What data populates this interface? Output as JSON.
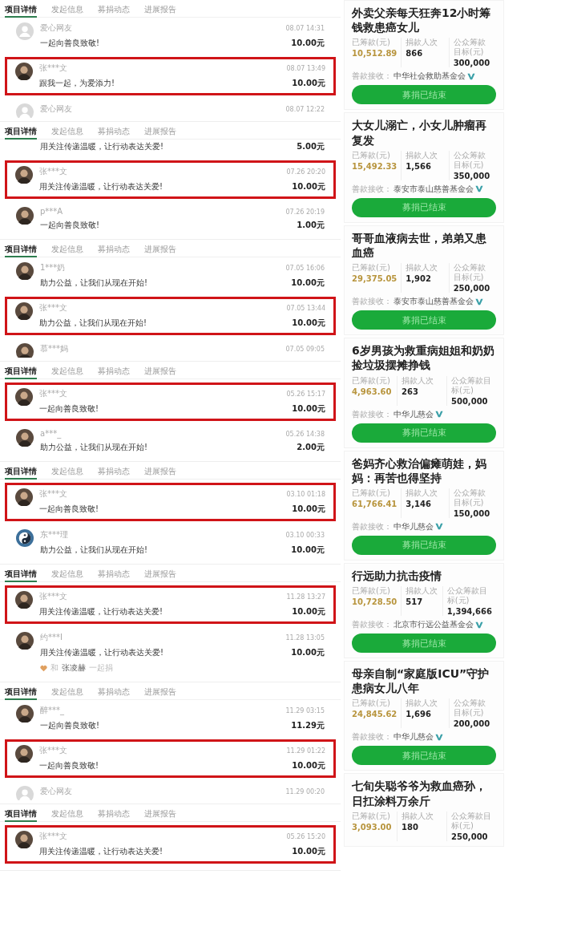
{
  "donation_panels": [
    {
      "tabs": [
        {
          "label": "项目详情",
          "selected": true
        },
        {
          "label": "发起信息",
          "selected": false
        },
        {
          "label": "募捐动态",
          "selected": false
        },
        {
          "label": "进展报告",
          "selected": false
        }
      ],
      "rows": [
        {
          "kind": "full",
          "avatar": {
            "kind": "default"
          },
          "name": "爱心网友",
          "time": "08.07 14:31",
          "message": "一起向善良致敬!",
          "amount": "10.00元",
          "highlighted": false
        },
        {
          "kind": "full",
          "avatar": {
            "kind": "photo"
          },
          "name": "张***文",
          "time": "08.07 13:49",
          "message": "跟我一起，为爱添力!",
          "amount": "10.00元",
          "highlighted": true
        },
        {
          "kind": "name_only",
          "avatar": {
            "kind": "default"
          },
          "name": "爱心网友",
          "time": "08.07 12:22",
          "highlighted": false
        }
      ]
    },
    {
      "tabs": [
        {
          "label": "项目详情",
          "selected": true
        },
        {
          "label": "发起信息",
          "selected": false
        },
        {
          "label": "募捐动态",
          "selected": false
        },
        {
          "label": "进展报告",
          "selected": false
        }
      ],
      "rows": [
        {
          "kind": "message_only",
          "message": "用关注传递温暖，让行动表达关爱!",
          "amount": "5.00元",
          "highlighted": false
        },
        {
          "kind": "full",
          "avatar": {
            "kind": "photo"
          },
          "name": "张***文",
          "time": "07.26 20:20",
          "message": "用关注传递温暖，让行动表达关爱!",
          "amount": "10.00元",
          "highlighted": true
        },
        {
          "kind": "full",
          "avatar": {
            "kind": "photo"
          },
          "name": "p***A",
          "time": "07.26 20:19",
          "message": "一起向善良致敬!",
          "amount": "1.00元",
          "highlighted": false
        }
      ]
    },
    {
      "tabs": [
        {
          "label": "项目详情",
          "selected": true
        },
        {
          "label": "发起信息",
          "selected": false
        },
        {
          "label": "募捐动态",
          "selected": false
        },
        {
          "label": "进展报告",
          "selected": false
        }
      ],
      "rows": [
        {
          "kind": "full",
          "avatar": {
            "kind": "photo"
          },
          "name": "1***奶",
          "time": "07.05 16:06",
          "message": "助力公益，让我们从现在开始!",
          "amount": "10.00元",
          "highlighted": false
        },
        {
          "kind": "full",
          "avatar": {
            "kind": "photo"
          },
          "name": "张***文",
          "time": "07.05 13:44",
          "message": "助力公益，让我们从现在开始!",
          "amount": "10.00元",
          "highlighted": true
        },
        {
          "kind": "name_only",
          "avatar": {
            "kind": "photo"
          },
          "name": "慕***妈",
          "time": "07.05 09:05",
          "highlighted": false
        }
      ]
    },
    {
      "tabs": [
        {
          "label": "项目详情",
          "selected": true
        },
        {
          "label": "发起信息",
          "selected": false
        },
        {
          "label": "募捐动态",
          "selected": false
        },
        {
          "label": "进展报告",
          "selected": false
        }
      ],
      "rows": [
        {
          "kind": "full",
          "avatar": {
            "kind": "photo"
          },
          "name": "张***文",
          "time": "05.26 15:17",
          "message": "一起向善良致敬!",
          "amount": "10.00元",
          "highlighted": true
        },
        {
          "kind": "full",
          "avatar": {
            "kind": "photo"
          },
          "name": "a***_",
          "time": "05.26 14:38",
          "message": "助力公益，让我们从现在开始!",
          "amount": "2.00元",
          "highlighted": false
        }
      ]
    },
    {
      "tabs": [
        {
          "label": "项目详情",
          "selected": true
        },
        {
          "label": "发起信息",
          "selected": false
        },
        {
          "label": "募捐动态",
          "selected": false
        },
        {
          "label": "进展报告",
          "selected": false
        }
      ],
      "rows": [
        {
          "kind": "full",
          "avatar": {
            "kind": "photo"
          },
          "name": "张***文",
          "time": "03.10 01:18",
          "message": "一起向善良致敬!",
          "amount": "10.00元",
          "highlighted": true
        },
        {
          "kind": "full",
          "avatar": {
            "kind": "yinyang"
          },
          "name": "东***理",
          "time": "03.10 00:33",
          "message": "助力公益，让我们从现在开始!",
          "amount": "10.00元",
          "highlighted": false
        }
      ]
    },
    {
      "tabs": [
        {
          "label": "项目详情",
          "selected": true
        },
        {
          "label": "发起信息",
          "selected": false
        },
        {
          "label": "募捐动态",
          "selected": false
        },
        {
          "label": "进展报告",
          "selected": false
        }
      ],
      "rows": [
        {
          "kind": "full",
          "avatar": {
            "kind": "photo"
          },
          "name": "张***文",
          "time": "11.28 13:27",
          "message": "用关注传递温暖，让行动表达关爱!",
          "amount": "10.00元",
          "highlighted": true
        },
        {
          "kind": "full",
          "avatar": {
            "kind": "photo"
          },
          "name": "约***I",
          "time": "11.28 13:05",
          "message": "用关注传递温暖，让行动表达关爱!",
          "amount": "10.00元",
          "highlighted": false,
          "together": {
            "prefix": "和",
            "name": "张凌赫",
            "suffix": "一起捐"
          }
        }
      ]
    },
    {
      "tabs": [
        {
          "label": "项目详情",
          "selected": true
        },
        {
          "label": "发起信息",
          "selected": false
        },
        {
          "label": "募捐动态",
          "selected": false
        },
        {
          "label": "进展报告",
          "selected": false
        }
      ],
      "rows": [
        {
          "kind": "full",
          "avatar": {
            "kind": "photo"
          },
          "name": "醉***_",
          "time": "11.29 03:15",
          "message": "一起向善良致敬!",
          "amount": "11.29元",
          "highlighted": false
        },
        {
          "kind": "full",
          "avatar": {
            "kind": "photo"
          },
          "name": "张***文",
          "time": "11.29 01:22",
          "message": "一起向善良致敬!",
          "amount": "10.00元",
          "highlighted": true
        },
        {
          "kind": "name_only",
          "avatar": {
            "kind": "default"
          },
          "name": "爱心网友",
          "time": "11.29 00:20",
          "highlighted": false
        }
      ]
    },
    {
      "tabs": [
        {
          "label": "项目详情",
          "selected": true
        },
        {
          "label": "发起信息",
          "selected": false
        },
        {
          "label": "募捐动态",
          "selected": false
        },
        {
          "label": "进展报告",
          "selected": false
        }
      ],
      "rows": [
        {
          "kind": "full",
          "avatar": {
            "kind": "photo"
          },
          "name": "张***文",
          "time": "05.26 15:20",
          "message": "用关注传递温暖，让行动表达关爱!",
          "amount": "10.00元",
          "highlighted": true
        }
      ]
    }
  ],
  "project_cards": [
    {
      "title": "外卖父亲每天狂奔12小时筹钱救患癌女儿",
      "stats": [
        {
          "label": "已筹款(元)",
          "value": "10,512.89"
        },
        {
          "label": "捐款人次",
          "value": "866"
        },
        {
          "label": "公众筹款目标(元)",
          "value": "300,000"
        }
      ],
      "recipient_label": "善款接收：",
      "recipient": "中华社会救助基金会",
      "button": "募捐已结束"
    },
    {
      "title": "大女儿溺亡，小女儿肿瘤再复发",
      "stats": [
        {
          "label": "已筹款(元)",
          "value": "15,492.33"
        },
        {
          "label": "捐款人次",
          "value": "1,566"
        },
        {
          "label": "公众筹款目标(元)",
          "value": "350,000"
        }
      ],
      "recipient_label": "善款接收：",
      "recipient": "泰安市泰山慈善基金会",
      "button": "募捐已结束"
    },
    {
      "title": "哥哥血液病去世，弟弟又患血癌",
      "stats": [
        {
          "label": "已筹款(元)",
          "value": "29,375.05"
        },
        {
          "label": "捐款人次",
          "value": "1,902"
        },
        {
          "label": "公众筹款目标(元)",
          "value": "250,000"
        }
      ],
      "recipient_label": "善款接收：",
      "recipient": "泰安市泰山慈善基金会",
      "button": "募捐已结束"
    },
    {
      "title": "6岁男孩为救重病姐姐和奶奶捡垃圾摆摊挣钱",
      "stats": [
        {
          "label": "已筹款(元)",
          "value": "4,963.60"
        },
        {
          "label": "捐款人次",
          "value": "263"
        },
        {
          "label": "公众筹款目标(元)",
          "value": "500,000"
        }
      ],
      "recipient_label": "善款接收：",
      "recipient": "中华儿慈会",
      "button": "募捐已结束"
    },
    {
      "title": "爸妈齐心救治偏瘫萌娃，妈妈：再苦也得坚持",
      "stats": [
        {
          "label": "已筹款(元)",
          "value": "61,766.41"
        },
        {
          "label": "捐款人次",
          "value": "3,146"
        },
        {
          "label": "公众筹款目标(元)",
          "value": "150,000"
        }
      ],
      "recipient_label": "善款接收：",
      "recipient": "中华儿慈会",
      "button": "募捐已结束"
    },
    {
      "title": "行远助力抗击疫情",
      "stats": [
        {
          "label": "已筹款(元)",
          "value": "10,728.50"
        },
        {
          "label": "捐款人次",
          "value": "517"
        },
        {
          "label": "公众筹款目标(元)",
          "value": "1,394,666"
        }
      ],
      "recipient_label": "善款接收：",
      "recipient": "北京市行远公益基金会",
      "button": "募捐已结束"
    },
    {
      "title": "母亲自制“家庭版ICU”守护患病女儿八年",
      "stats": [
        {
          "label": "已筹款(元)",
          "value": "24,845.62"
        },
        {
          "label": "捐款人次",
          "value": "1,696"
        },
        {
          "label": "公众筹款目标(元)",
          "value": "200,000"
        }
      ],
      "recipient_label": "善款接收：",
      "recipient": "中华儿慈会",
      "button": "募捐已结束"
    },
    {
      "title": "七旬失聪爷爷为救血癌孙，日扛涂料万余斤",
      "stats": [
        {
          "label": "已筹款(元)",
          "value": "3,093.00"
        },
        {
          "label": "捐款人次",
          "value": "180"
        },
        {
          "label": "公众筹款目标(元)",
          "value": "250,000"
        }
      ]
    }
  ]
}
